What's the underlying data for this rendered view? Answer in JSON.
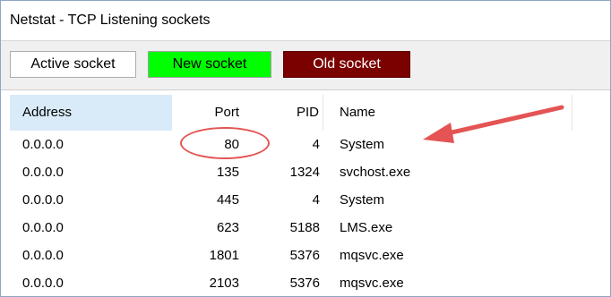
{
  "window": {
    "title": "Netstat - TCP Listening sockets"
  },
  "toolbar": {
    "active_label": "Active socket",
    "new_label": "New socket",
    "old_label": "Old socket",
    "colors": {
      "new_bg": "#00ff00",
      "old_bg": "#7b0000",
      "old_text": "#ffffff"
    }
  },
  "table": {
    "columns": [
      "Address",
      "Port",
      "PID",
      "Name"
    ],
    "sorted_column": "Address",
    "rows": [
      {
        "address": "0.0.0.0",
        "port": "80",
        "pid": "4",
        "name": "System"
      },
      {
        "address": "0.0.0.0",
        "port": "135",
        "pid": "1324",
        "name": "svchost.exe"
      },
      {
        "address": "0.0.0.0",
        "port": "445",
        "pid": "4",
        "name": "System"
      },
      {
        "address": "0.0.0.0",
        "port": "623",
        "pid": "5188",
        "name": "LMS.exe"
      },
      {
        "address": "0.0.0.0",
        "port": "1801",
        "pid": "5376",
        "name": "mqsvc.exe"
      },
      {
        "address": "0.0.0.0",
        "port": "2103",
        "pid": "5376",
        "name": "mqsvc.exe"
      }
    ]
  },
  "annotations": {
    "color": "#e45454",
    "circle_target": "port 80",
    "arrow_target": "System"
  }
}
